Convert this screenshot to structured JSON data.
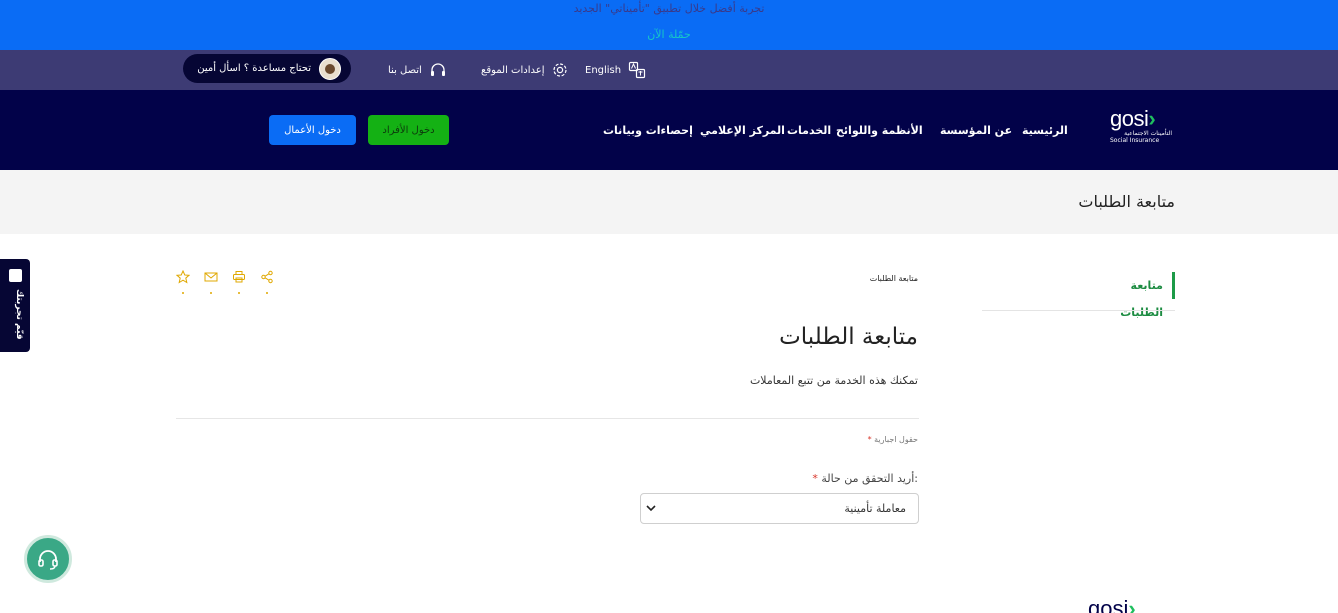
{
  "promo": {
    "text": "تجربة أفضل خلال تطبيق \"تأميناتي\" الجديد",
    "link": "حمّلة الآن"
  },
  "utility": {
    "language": "English",
    "settings": "إعدادات الموقع",
    "contact": "اتصل بنا",
    "assistant": "تحتاج مساعدة ؟ اسأل أمين"
  },
  "logo": {
    "brand": "gosi",
    "arabic": "التأمينات الاجتماعية",
    "english": "Social Insurance"
  },
  "nav": {
    "items": [
      "الرئيسية",
      "عن المؤسسة",
      "الأنظمة واللوائح",
      "الخدمات",
      "المركز الإعلامي",
      "إحصاءات وبيانات"
    ],
    "individuals_login": "دخول الأفراد",
    "business_login": "دخول الأعمال"
  },
  "page": {
    "band_title": "متابعة الطلبات",
    "breadcrumb": "متابعة الطلبات",
    "title": "متابعة الطلبات",
    "description": "تمكنك هذه الخدمة من تتبع المعاملات"
  },
  "sidebar": {
    "items": [
      {
        "label": "متابعة الطلبات"
      }
    ]
  },
  "form": {
    "required_note": "حقول اجبارية",
    "required_mark": "*",
    "check_label": "أريد التحقق من حالة:",
    "select_value": "معاملة تأمينية"
  },
  "feedback": {
    "label": "قيّم تجربتك"
  },
  "footer": {
    "brand": "gosi"
  },
  "colors": {
    "promo_bg": "#0a6cf5",
    "utility_bg": "#3d3b74",
    "nav_bg": "#020249",
    "accent_green": "#1d9b48",
    "individuals_btn": "#14b114",
    "business_btn": "#0a6cf5",
    "tool_icons": "#e0a800"
  },
  "icons": [
    "translate-icon",
    "gear-icon",
    "headset-icon",
    "share-icon",
    "print-icon",
    "mail-icon",
    "star-icon",
    "chevron-down-icon",
    "support-headset-icon"
  ]
}
